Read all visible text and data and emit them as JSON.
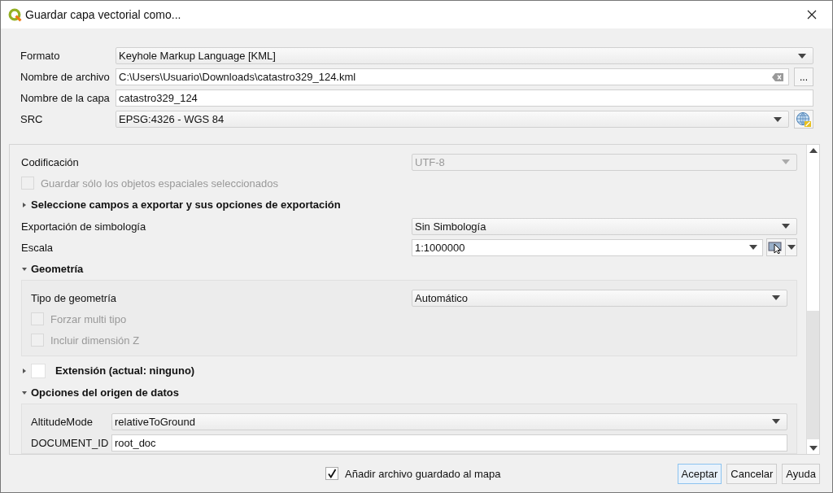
{
  "window": {
    "title": "Guardar capa vectorial como..."
  },
  "top_fields": [
    {
      "kind": "combo",
      "label": "Formato",
      "value": "Keyhole Markup Language [KML]"
    },
    {
      "kind": "file",
      "label": "Nombre de archivo",
      "value": "C:\\Users\\Usuario\\Downloads\\catastro329_124.kml",
      "browse": "..."
    },
    {
      "kind": "text",
      "label": "Nombre de la capa",
      "value": "catastro329_124"
    },
    {
      "kind": "crs",
      "label": "SRC",
      "value": "EPSG:4326 - WGS 84"
    }
  ],
  "options": {
    "encoding": {
      "label": "Codificación",
      "value": "UTF-8",
      "disabled": true
    },
    "selected_only": {
      "label": "Guardar sólo los objetos espaciales seleccionados",
      "checked": false,
      "disabled": true
    },
    "fields_section": {
      "title": "Seleccione campos a exportar y sus opciones de exportación",
      "expanded": false
    },
    "symbology": {
      "label": "Exportación de simbología",
      "value": "Sin Simbología"
    },
    "scale": {
      "label": "Escala",
      "value": "1:1000000"
    },
    "geometry": {
      "title": "Geometría",
      "expanded": true,
      "type_label": "Tipo de geometría",
      "type_value": "Automático",
      "checks": [
        {
          "label": "Forzar multi tipo",
          "checked": false,
          "disabled": true
        },
        {
          "label": "Incluir dimensión Z",
          "checked": false,
          "disabled": true
        }
      ]
    },
    "extent": {
      "title": "Extensión (actual: ninguno)",
      "expanded": false,
      "checked": false
    },
    "datasource": {
      "title": "Opciones del origen de datos",
      "expanded": true,
      "rows": [
        {
          "kind": "combo",
          "label": "AltitudeMode",
          "value": "relativeToGround"
        },
        {
          "kind": "text",
          "label": "DOCUMENT_ID",
          "value": "root_doc"
        }
      ]
    }
  },
  "footer": {
    "add_to_map": {
      "label": "Añadir archivo guardado al mapa",
      "checked": true
    },
    "buttons": [
      {
        "label": "Aceptar",
        "default": true
      },
      {
        "label": "Cancelar",
        "default": false
      },
      {
        "label": "Ayuda",
        "default": false
      }
    ]
  }
}
